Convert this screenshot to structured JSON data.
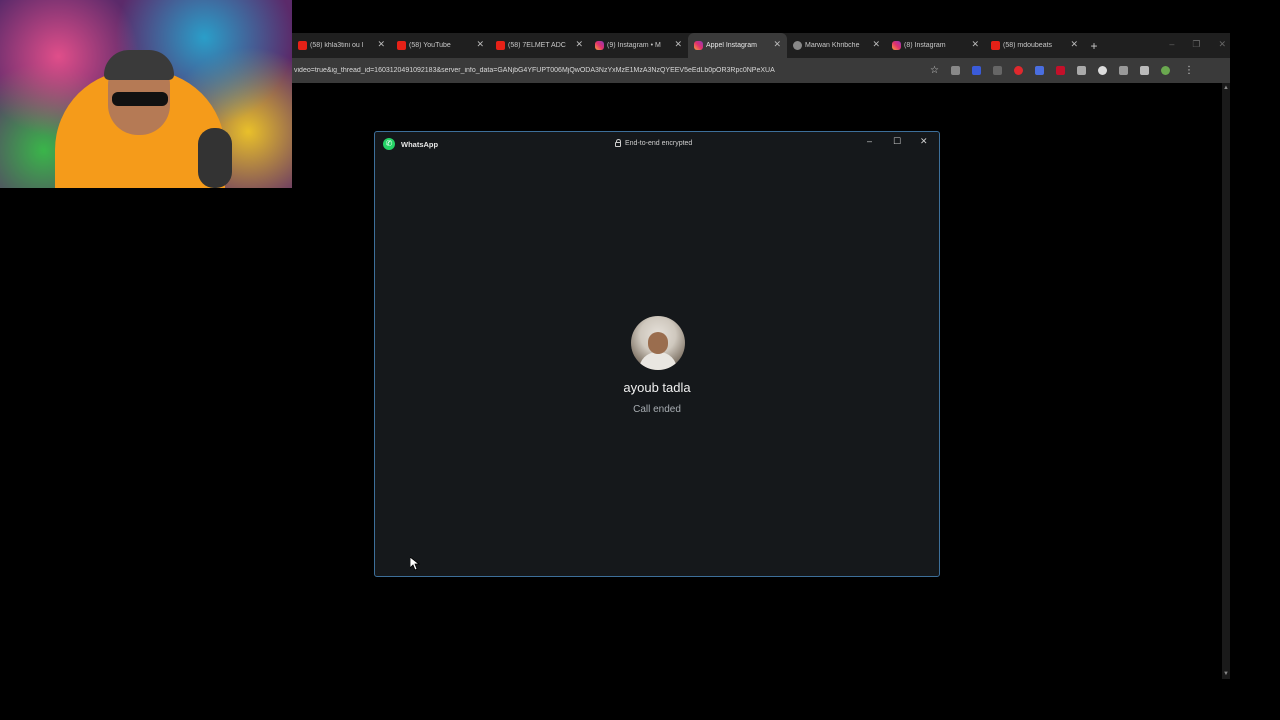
{
  "browser": {
    "tabs": [
      {
        "title": "(58) khla3tini ou l",
        "favicon": "youtube-icon",
        "active": false
      },
      {
        "title": "(58) YouTube",
        "favicon": "youtube-icon",
        "active": false
      },
      {
        "title": "(58) 7ELMET ADC",
        "favicon": "youtube-icon",
        "active": false
      },
      {
        "title": "(9) Instagram • M",
        "favicon": "instagram-icon",
        "active": false
      },
      {
        "title": "Appel Instagram",
        "favicon": "instagram-icon",
        "active": true
      },
      {
        "title": "Marwan Khribche",
        "favicon": "avatar-icon",
        "active": false
      },
      {
        "title": "(8) Instagram",
        "favicon": "instagram-icon",
        "active": false
      },
      {
        "title": "(58) mdoubeats",
        "favicon": "youtube-icon",
        "active": false
      }
    ],
    "new_tab_symbol": "+",
    "url": "video=true&ig_thread_id=1603120491092183&server_info_data=GANjbG4YFUPT006MjQwODA3NzYxMzE1MzA3NzQYEEV5eEdLb0pOR3Rpc0NPeXUA"
  },
  "whatsapp": {
    "app_name": "WhatsApp",
    "encryption_label": "End-to-end encrypted",
    "minimize_symbol": "–",
    "maximize_symbol": "☐",
    "close_symbol": "✕",
    "caller_name": "ayoub tadla",
    "call_status": "Call ended"
  },
  "colors": {
    "accent": "#25d366",
    "window_border": "#3d6f9a",
    "window_bg": "#15181b"
  }
}
